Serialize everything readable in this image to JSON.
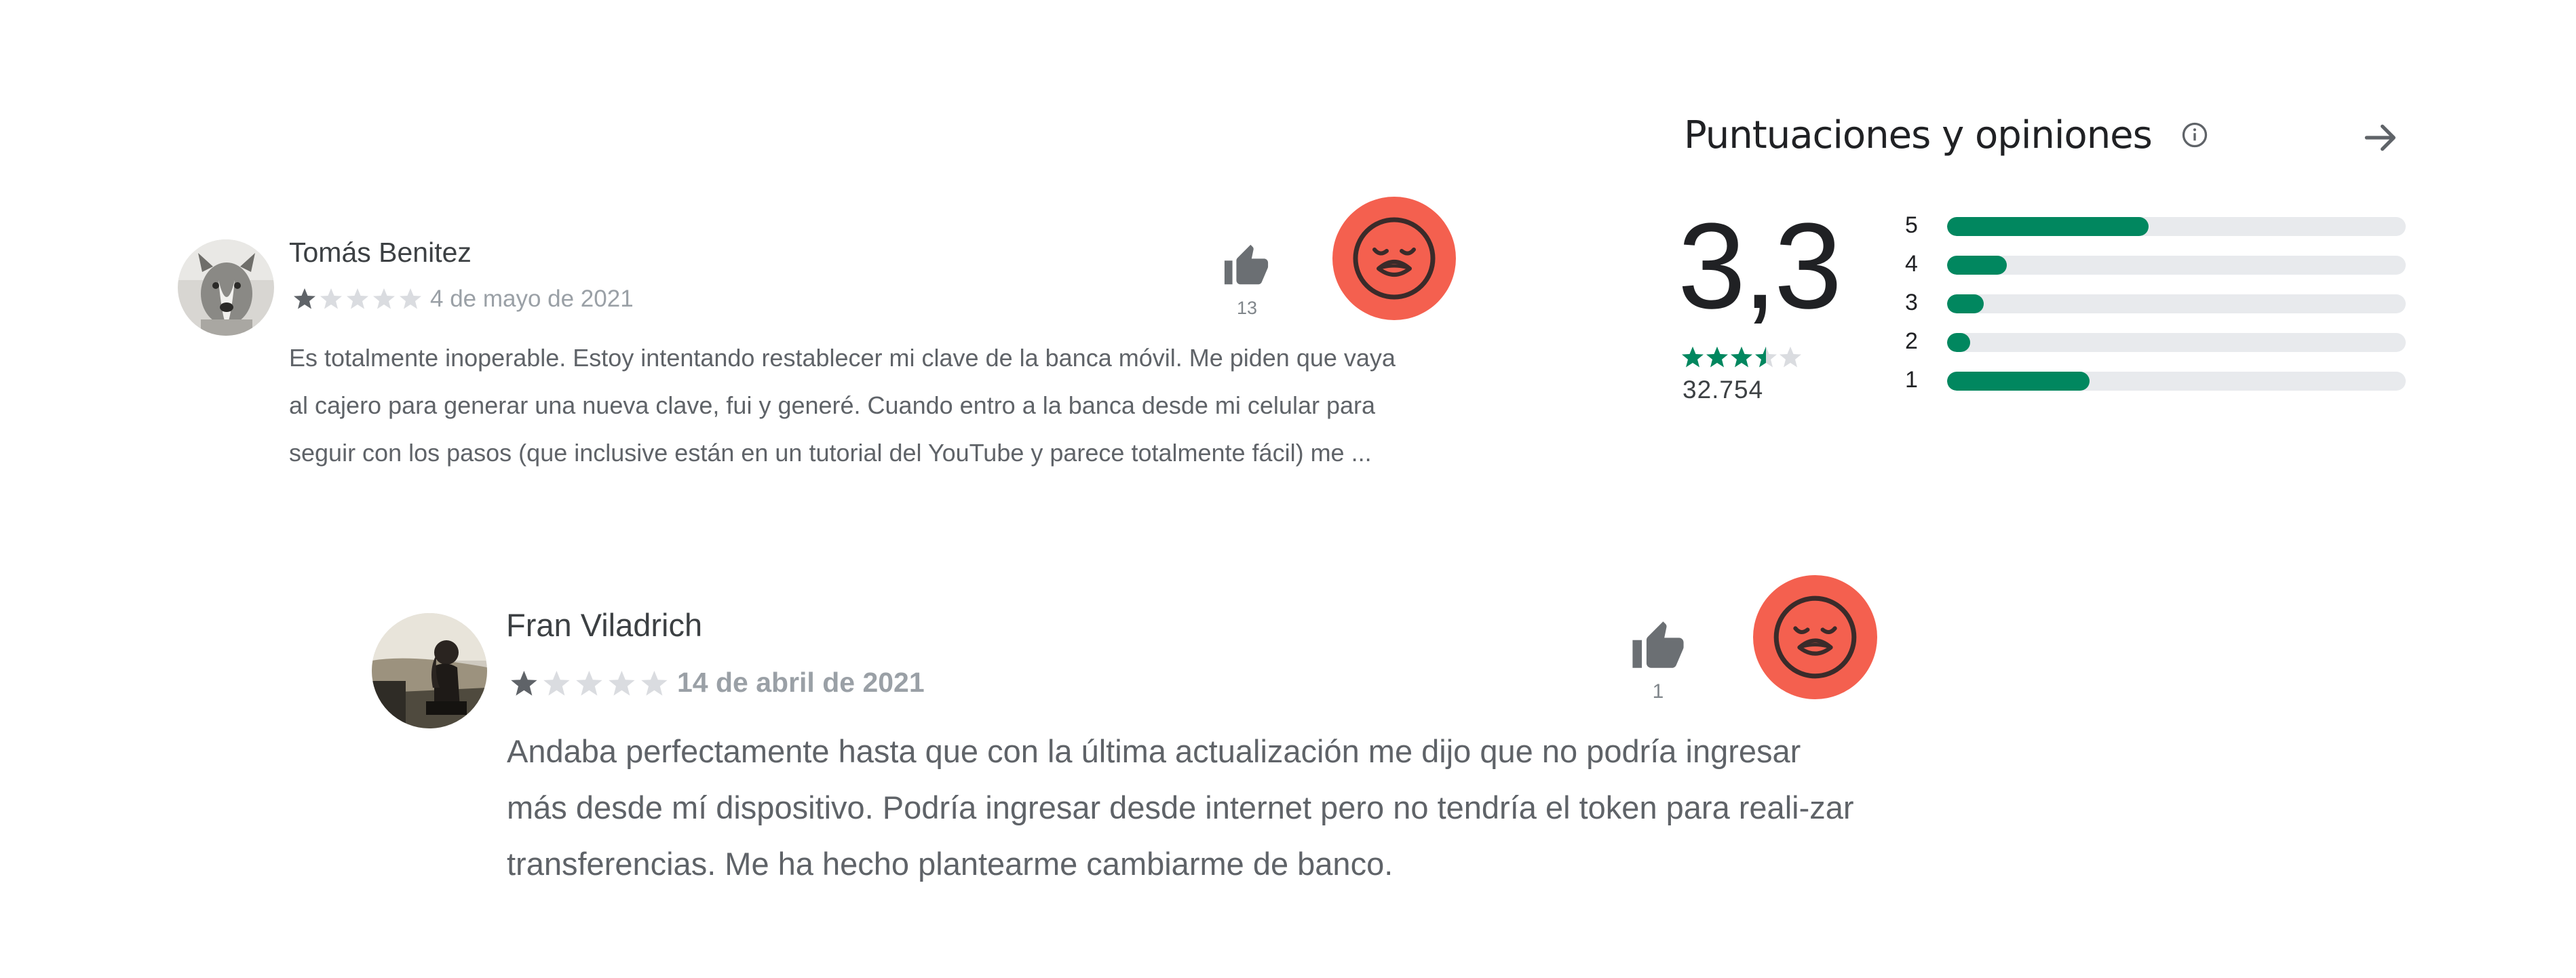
{
  "ratings": {
    "title": "Puntuaciones y opiniones",
    "score": "3,3",
    "review_count": "32.754",
    "star_rating": 3.5,
    "accent_color": "#01875f",
    "icons": [
      "info-icon",
      "arrow-right-icon"
    ],
    "histogram": [
      {
        "label": "5",
        "fraction": 0.44
      },
      {
        "label": "4",
        "fraction": 0.13
      },
      {
        "label": "3",
        "fraction": 0.08
      },
      {
        "label": "2",
        "fraction": 0.05
      },
      {
        "label": "1",
        "fraction": 0.31
      }
    ]
  },
  "reviews": [
    {
      "name": "Tomás Benitez",
      "rating": 1,
      "date": "4 de mayo de 2021",
      "text": "Es totalmente inoperable. Estoy intentando restablecer mi clave de la banca móvil. Me piden que vaya al cajero para generar una nueva clave, fui y generé. Cuando entro a la banca desde mi celular para seguir con los pasos (que inclusive están en un tutorial del YouTube y parece totalmente fácil) me ...",
      "helpful_count": "13",
      "icons": [
        "avatar",
        "thumbs-up-icon",
        "sad-face-icon"
      ]
    },
    {
      "name": "Fran Viladrich",
      "rating": 1,
      "date": "14 de abril de 2021",
      "text": "Andaba perfectamente hasta que con la última actualización me dijo que no podría ingresar más desde mí dispositivo. Podría ingresar desde internet pero no tendría el token para reali-zar transferencias. Me ha hecho plantearme cambiarme de banco.",
      "helpful_count": "1",
      "icons": [
        "avatar",
        "thumbs-up-icon",
        "sad-face-icon"
      ]
    }
  ],
  "badge_color": "#f4604f"
}
